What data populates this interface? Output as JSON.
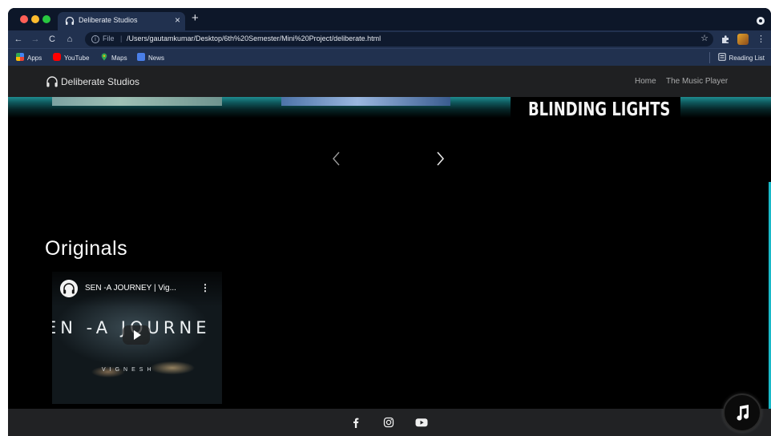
{
  "browser": {
    "tab": {
      "title": "Deliberate Studios",
      "close": "×",
      "icon": "headphones-icon"
    },
    "new_tab": "+",
    "toolbar": {
      "back": "←",
      "forward": "→",
      "reload": "C",
      "home": "⌂",
      "scheme": "File",
      "url": "/Users/gautamkumar/Desktop/6th%20Semester/Mini%20Project/deliberate.html",
      "bookmark_star": "☆",
      "extensions": "puzzle-icon",
      "menu": "⋮"
    },
    "bookmarks": [
      {
        "label": "Apps",
        "icon": "apps-grid-icon"
      },
      {
        "label": "YouTube",
        "icon": "youtube-icon"
      },
      {
        "label": "Maps",
        "icon": "maps-pin-icon"
      },
      {
        "label": "News",
        "icon": "news-icon"
      }
    ],
    "reading_list": "Reading List"
  },
  "site": {
    "brand": "Deliberate Studios",
    "nav": {
      "home": "Home",
      "player": "The Music Player"
    },
    "carousel": {
      "slide_text": "BLINDING LIGHTS"
    },
    "originals": {
      "heading": "Originals",
      "video": {
        "title": "SEN -A JOURNEY | Vig...",
        "overlay_text": "EN -A JOURNE",
        "overlay_sub": "VIGNESH"
      }
    },
    "footer": {
      "icons": [
        "facebook-icon",
        "instagram-icon",
        "youtube-icon"
      ]
    },
    "accent": "#19b8c7"
  }
}
